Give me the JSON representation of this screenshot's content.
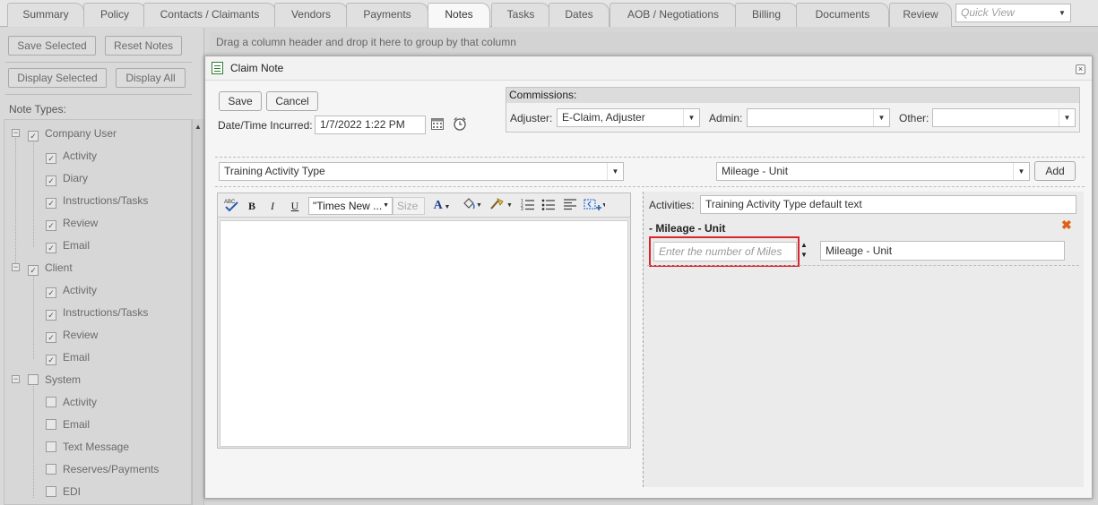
{
  "tabs": [
    {
      "label": "Summary",
      "active": false
    },
    {
      "label": "Policy",
      "active": false
    },
    {
      "label": "Contacts / Claimants",
      "active": false
    },
    {
      "label": "Vendors",
      "active": false
    },
    {
      "label": "Payments",
      "active": false
    },
    {
      "label": "Notes",
      "active": true
    },
    {
      "label": "Tasks",
      "active": false
    },
    {
      "label": "Dates",
      "active": false
    },
    {
      "label": "AOB / Negotiations",
      "active": false
    },
    {
      "label": "Billing",
      "active": false
    },
    {
      "label": "Documents",
      "active": false
    },
    {
      "label": "Review",
      "active": false
    }
  ],
  "quick_view": {
    "placeholder": "Quick View"
  },
  "left_panel": {
    "save_selected": "Save Selected",
    "reset_notes": "Reset Notes",
    "display_selected": "Display Selected",
    "display_all": "Display All",
    "note_types_label": "Note Types:",
    "tree": [
      {
        "label": "Company User",
        "checked": true,
        "children": [
          {
            "label": "Activity",
            "checked": true
          },
          {
            "label": "Diary",
            "checked": true
          },
          {
            "label": "Instructions/Tasks",
            "checked": true
          },
          {
            "label": "Review",
            "checked": true
          },
          {
            "label": "Email",
            "checked": true
          }
        ]
      },
      {
        "label": "Client",
        "checked": true,
        "children": [
          {
            "label": "Activity",
            "checked": true
          },
          {
            "label": "Instructions/Tasks",
            "checked": true
          },
          {
            "label": "Review",
            "checked": true
          },
          {
            "label": "Email",
            "checked": true
          }
        ]
      },
      {
        "label": "System",
        "checked": false,
        "children": [
          {
            "label": "Activity",
            "checked": false
          },
          {
            "label": "Email",
            "checked": false
          },
          {
            "label": "Text Message",
            "checked": false
          },
          {
            "label": "Reserves/Payments",
            "checked": false
          },
          {
            "label": "EDI",
            "checked": false
          }
        ]
      }
    ]
  },
  "grid": {
    "group_hint": "Drag a column header and drop it here to group by that column"
  },
  "dialog": {
    "title": "Claim Note",
    "save_label": "Save",
    "cancel_label": "Cancel",
    "date_label": "Date/Time Incurred:",
    "date_value": "1/7/2022 1:22 PM",
    "commissions": {
      "header": "Commissions:",
      "adjuster_label": "Adjuster:",
      "adjuster_value": "E-Claim, Adjuster",
      "admin_label": "Admin:",
      "admin_value": "",
      "other_label": "Other:",
      "other_value": ""
    },
    "activity_type_value": "Training Activity Type",
    "unit_type_value": "Mileage - Unit",
    "add_label": "Add",
    "editor": {
      "font_value": "\"Times New ...",
      "size_placeholder": "Size",
      "body": ""
    },
    "activities": {
      "label": "Activities:",
      "value": "Training Activity Type default text",
      "section_title": "- Mileage - Unit",
      "miles_placeholder": "Enter the number of Miles",
      "unit_value": "Mileage - Unit"
    }
  },
  "icons": {
    "note": "note-icon",
    "calendar": "calendar-icon",
    "clock": "alarm-clock-icon",
    "delete": "delete-x-icon"
  },
  "colors": {
    "highlight_border": "#d9262c",
    "delete_icon": "#e06019",
    "note_icon": "#2f7d32"
  }
}
